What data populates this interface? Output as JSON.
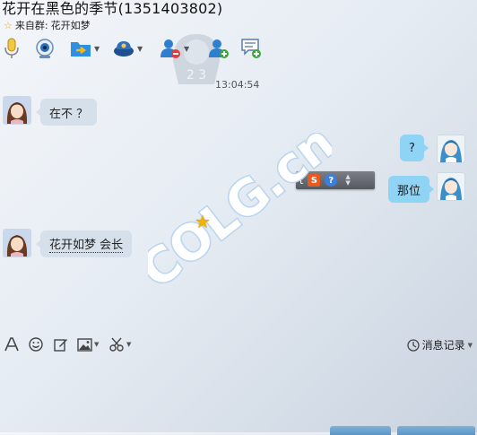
{
  "window": {
    "title": "花开在黑色的季节(1351403802)",
    "source_prefix": "来自群:",
    "source_group": "花开如梦"
  },
  "toolbar": {
    "icons": [
      "microphone-icon",
      "webcam-icon",
      "send-file-icon",
      "remote-assist-icon",
      "block-user-icon",
      "add-friend-icon",
      "message-add-icon"
    ]
  },
  "chat": {
    "timestamp": "13:04:54",
    "messages": [
      {
        "side": "left",
        "text": "在不 ？"
      },
      {
        "side": "right",
        "text": "?"
      },
      {
        "side": "right",
        "text": "那位"
      },
      {
        "side": "left",
        "text": "花开如梦 会长"
      }
    ]
  },
  "overlay": {
    "watermark_text": "COLG.cn",
    "badge_text": "2 3",
    "popup_partial": "t",
    "popup_s_label": "S",
    "popup_help_label": "?"
  },
  "input_toolbar": {
    "history_label": "消息记录"
  },
  "colors": {
    "bubble_in": "#d6e0ea",
    "bubble_out": "#8fd4f5",
    "accent": "#3d7ed8"
  }
}
